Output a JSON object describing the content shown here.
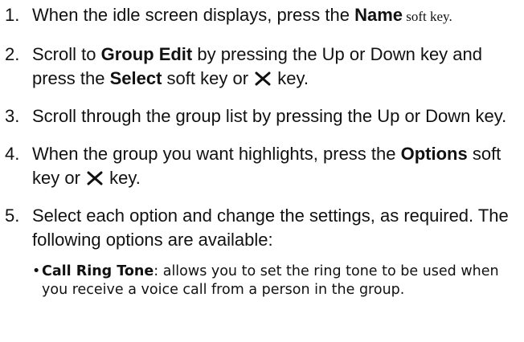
{
  "steps": [
    {
      "num": "1.",
      "t1": "When the idle screen displays, press the ",
      "b1": "Name",
      "t2": " soft key."
    },
    {
      "num": "2.",
      "t1": "Scroll to ",
      "b1": "Group Edit",
      "t2": " by pressing the Up or Down key and press the ",
      "b2": "Select",
      "t3": " soft key or ",
      "t4": " key."
    },
    {
      "num": "3.",
      "t1": "Scroll through the group list by pressing the Up or Down key."
    },
    {
      "num": "4.",
      "t1": "When the group you want highlights, press the ",
      "b1": "Options",
      "t2": " soft key or ",
      "t3": " key."
    },
    {
      "num": "5.",
      "t1": "Select each option and change the settings, as required. The following options are available:"
    }
  ],
  "options": [
    {
      "bullet": "•",
      "name": "Call Ring Tone",
      "desc": ": allows you to set the ring tone to be used when you receive a voice call from a person in the group."
    }
  ],
  "icons": {
    "center_key": "center-key-icon"
  }
}
